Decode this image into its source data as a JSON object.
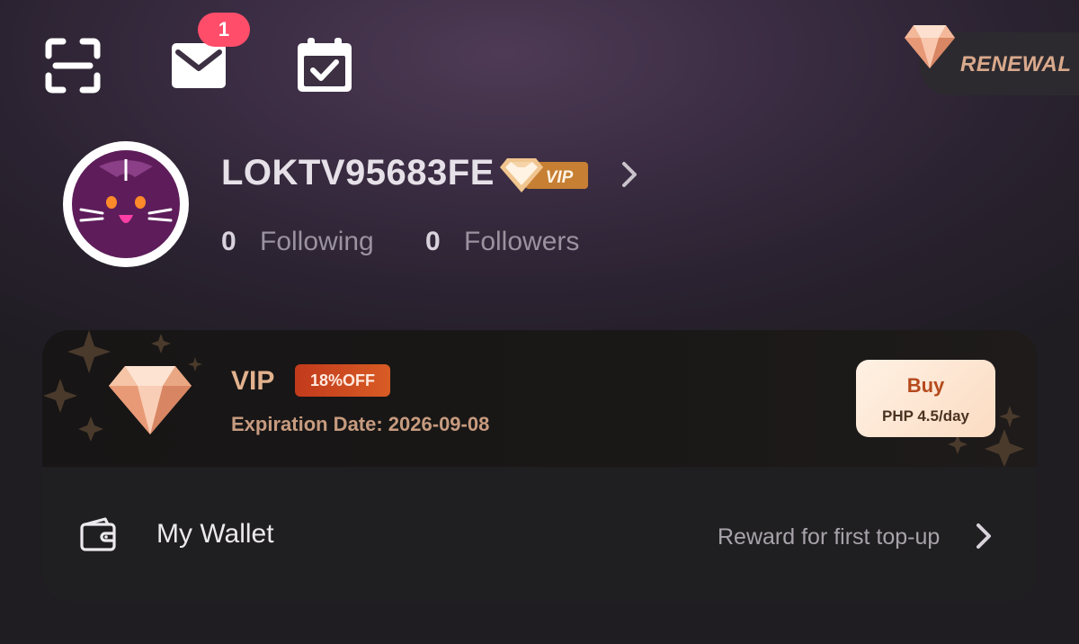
{
  "header": {
    "icons": [
      "scan-icon",
      "mail-icon",
      "calendar-check-icon"
    ],
    "mail_badge": "1",
    "renewal_label": "RENEWAL"
  },
  "profile": {
    "username": "LOKTV95683FE",
    "vip_tag": "VIP",
    "following_count": "0",
    "following_label": "Following",
    "followers_count": "0",
    "followers_label": "Followers"
  },
  "vip_card": {
    "title": "VIP",
    "discount": "18%OFF",
    "expiration": "Expiration Date: 2026-09-08",
    "buy_label": "Buy",
    "buy_price": "PHP 4.5/day"
  },
  "wallet": {
    "label": "My Wallet",
    "reward_text": "Reward for first top-up"
  },
  "colors": {
    "badge": "#ff4d6a",
    "gold": "#e2b28e",
    "discount": "#c23a1c",
    "card_bg": "#1f1e20"
  }
}
